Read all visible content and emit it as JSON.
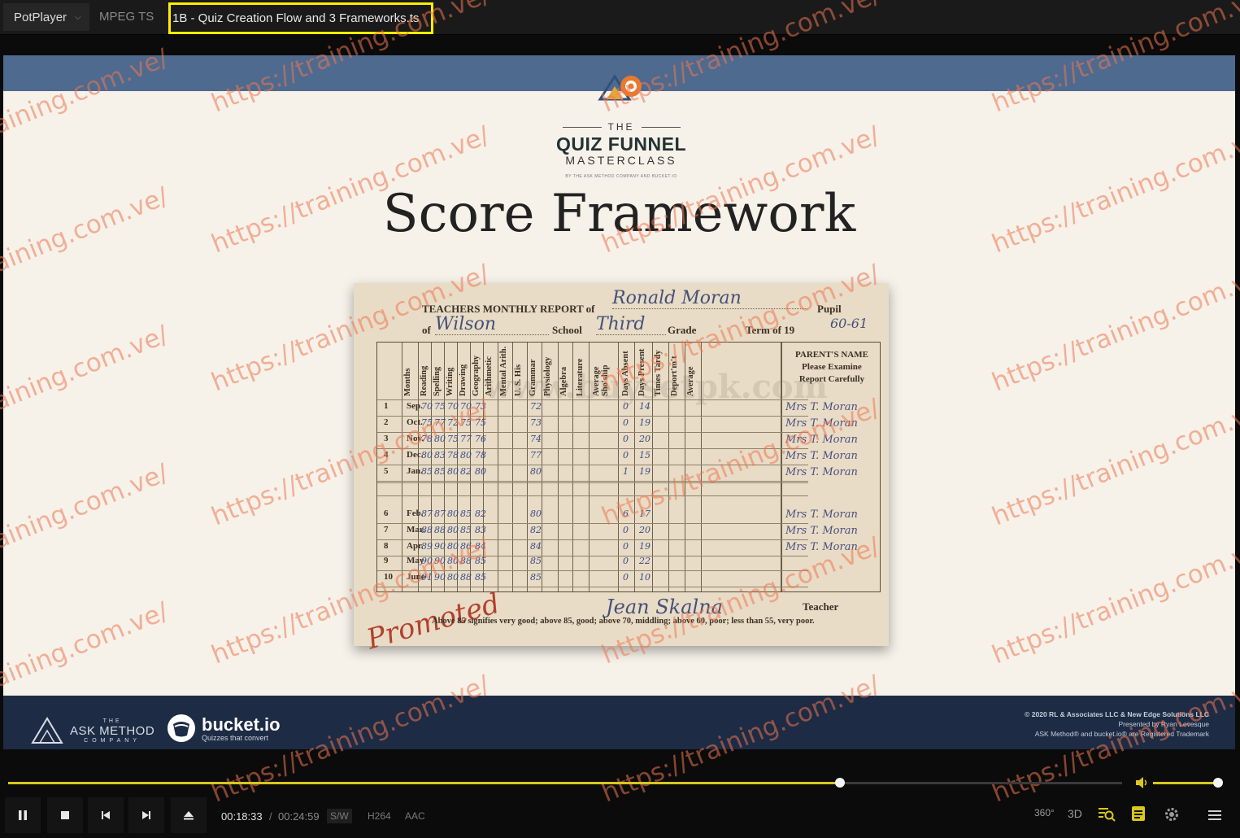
{
  "titlebar": {
    "app_name": "PotPlayer",
    "format": "MPEG TS",
    "file_title": "1B - Quiz Creation Flow and 3 Frameworks.ts"
  },
  "slide": {
    "logo_the": "THE",
    "logo_main": "QUIZ FUNNEL",
    "logo_sub": "MASTERCLASS",
    "logo_tiny": "BY THE ASK METHOD COMPANY AND BUCKET.IO",
    "title": "Score Framework",
    "footer": {
      "ask_the": "THE",
      "ask_name": "ASK METHOD",
      "ask_company": "COMPANY",
      "bucket_name": "bucket.io",
      "bucket_tagline": "Quizzes that convert",
      "legal_1": "© 2020 RL & Associates LLC & New Edge Solutions LLC",
      "legal_2": "Presented by Ryan Levesque",
      "legal_3": "ASK Method® and bucket.io® are Registered Trademark"
    }
  },
  "report_card": {
    "header": "TEACHERS MONTHLY REPORT of",
    "pupil_name": "Ronald Moran",
    "pupil_label": "Pupil",
    "of_label": "of",
    "school_name": "Wilson",
    "school_label": "School",
    "grade_value": "Third",
    "grade_label": "Grade",
    "term_label": "Term of 19",
    "term_value": "60-61",
    "subjects": [
      "Months",
      "Reading",
      "Spelling",
      "Writing",
      "Drawing",
      "Geography",
      "Arithmetic",
      "Mental Arith.",
      "U. S. His",
      "Grammar",
      "Physiology",
      "Algebra",
      "Literature",
      "Average Sho'ship",
      "Days Absent",
      "Days Present",
      "Times Tardy",
      "Deport'm't",
      "Average"
    ],
    "parents_header": [
      "PARENT'S NAME",
      "Please Examine",
      "Report Carefully"
    ],
    "rows": [
      {
        "n": "1",
        "month": "Sep.",
        "grades": [
          "70",
          "75",
          "70",
          "70"
        ],
        "arith": "73",
        "gram": "72",
        "absent": "0",
        "present": "14",
        "sig": "Mrs T. Moran"
      },
      {
        "n": "2",
        "month": "Oct.",
        "grades": [
          "75",
          "77",
          "72",
          "75"
        ],
        "arith": "75",
        "gram": "73",
        "absent": "0",
        "present": "19",
        "sig": "Mrs T. Moran"
      },
      {
        "n": "3",
        "month": "Nov.",
        "grades": [
          "78",
          "80",
          "75",
          "77"
        ],
        "arith": "76",
        "gram": "74",
        "absent": "0",
        "present": "20",
        "sig": "Mrs T. Moran"
      },
      {
        "n": "4",
        "month": "Dec.",
        "grades": [
          "80",
          "83",
          "78",
          "80"
        ],
        "arith": "78",
        "gram": "77",
        "absent": "0",
        "present": "15",
        "sig": "Mrs T. Moran"
      },
      {
        "n": "5",
        "month": "Jan.",
        "grades": [
          "85",
          "85",
          "80",
          "82"
        ],
        "arith": "80",
        "gram": "80",
        "absent": "1",
        "present": "19",
        "sig": "Mrs T. Moran"
      },
      {
        "n": "6",
        "month": "Feb.",
        "grades": [
          "87",
          "87",
          "80",
          "85"
        ],
        "arith": "82",
        "gram": "80",
        "absent": "6",
        "present": "17",
        "sig": "Mrs T. Moran"
      },
      {
        "n": "7",
        "month": "Mar.",
        "grades": [
          "88",
          "88",
          "80",
          "85"
        ],
        "arith": "83",
        "gram": "82",
        "absent": "0",
        "present": "20",
        "sig": "Mrs T. Moran"
      },
      {
        "n": "8",
        "month": "Apr.",
        "grades": [
          "89",
          "90",
          "80",
          "86"
        ],
        "arith": "84",
        "gram": "84",
        "absent": "0",
        "present": "19",
        "sig": "Mrs T. Moran"
      },
      {
        "n": "9",
        "month": "May",
        "grades": [
          "90",
          "90",
          "80",
          "88"
        ],
        "arith": "85",
        "gram": "85",
        "absent": "0",
        "present": "22",
        "sig": ""
      },
      {
        "n": "10",
        "month": "June",
        "grades": [
          "91",
          "90",
          "80",
          "88"
        ],
        "arith": "85",
        "gram": "85",
        "absent": "0",
        "present": "10",
        "sig": ""
      }
    ],
    "promoted": "Promoted",
    "teacher_signature": "Jean Skalna",
    "teacher_label": "Teacher",
    "legend": "Above 85 signifies very good; above 85, good; above 70, middling; above 60, poor; less than 55, very poor."
  },
  "watermark": {
    "text": "https://training.com.ve/",
    "stamp": "www.buysetpk.com",
    "color": "#ee7650"
  },
  "controls": {
    "seek_progress": 0.7466,
    "volume_level": 1.0,
    "time_current": "00:18:33",
    "time_separator": "/",
    "time_total": "00:24:59",
    "sw_label": "S/W",
    "video_codec": "H264",
    "audio_codec": "AAC",
    "btn_360": "360°",
    "btn_3d": "3D",
    "accent_color": "#d9c71e",
    "icons": [
      "pause-icon",
      "stop-icon",
      "previous-icon",
      "next-icon",
      "eject-icon",
      "volume-icon",
      "playlist-search-icon",
      "subtitle-icon",
      "settings-icon",
      "menu-icon"
    ]
  }
}
